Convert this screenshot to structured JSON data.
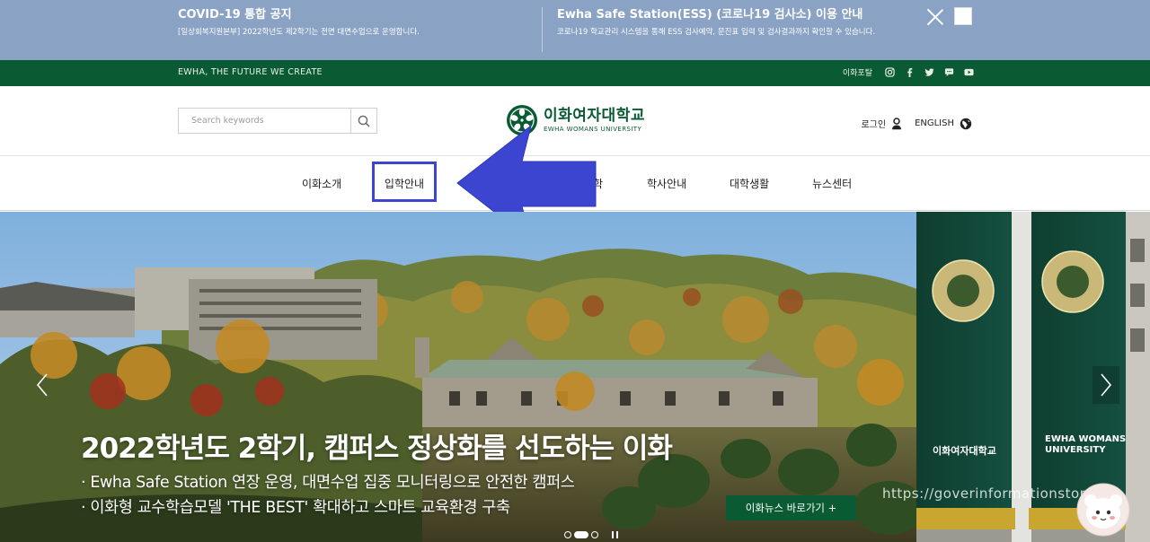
{
  "notice": {
    "left": {
      "title": "COVID-19 통합 공지",
      "text": "[일상회복지원본부] 2022학년도 제2학기는 전면 대면수업으로 운영합니다."
    },
    "right": {
      "title": "Ewha Safe Station(ESS) (코로나19 검사소) 이용 안내",
      "text": "코로나19 학교관리 시스템을 통해 ESS 검사예약, 문진표 입력 및 검사결과까지 확인할 수 있습니다."
    }
  },
  "topbar": {
    "slogan": "EWHA, THE FUTURE WE CREATE",
    "portal_label": "이화포탈",
    "sns_icons": [
      "instagram-icon",
      "facebook-icon",
      "twitter-icon",
      "chat-icon",
      "youtube-icon"
    ]
  },
  "header": {
    "search_placeholder": "Search keywords",
    "logo_kr": "이화여자대학교",
    "logo_en": "EWHA WOMANS UNIVERSITY",
    "login_label": "로그인",
    "language_label": "ENGLISH"
  },
  "gnb": {
    "items": [
      "이화소개",
      "입학안내",
      "학",
      "학사안내",
      "대학생활",
      "뉴스센터"
    ],
    "highlighted": "입학안내"
  },
  "hero": {
    "title": "2022학년도 2학기, 캠퍼스 정상화를 선도하는 이화",
    "line1": "· Ewha Safe Station 연장 운영, 대면수업 집중 모니터링으로 안전한 캠퍼스",
    "line2": "· 이화형 교수학습모델 'THE BEST' 확대하고 스마트 교육환경 구축",
    "button": "이화뉴스 바로가기 +",
    "watermark": "https://goverinformationstory",
    "banner_kr": "이화여자대학교",
    "banner_en_1": "EWHA WOMANS",
    "banner_en_2": "UNIVERSITY"
  },
  "colors": {
    "ewha_green": "#0a5b33",
    "notice_blue": "#8aa2c3",
    "highlight": "#3b45d0"
  }
}
